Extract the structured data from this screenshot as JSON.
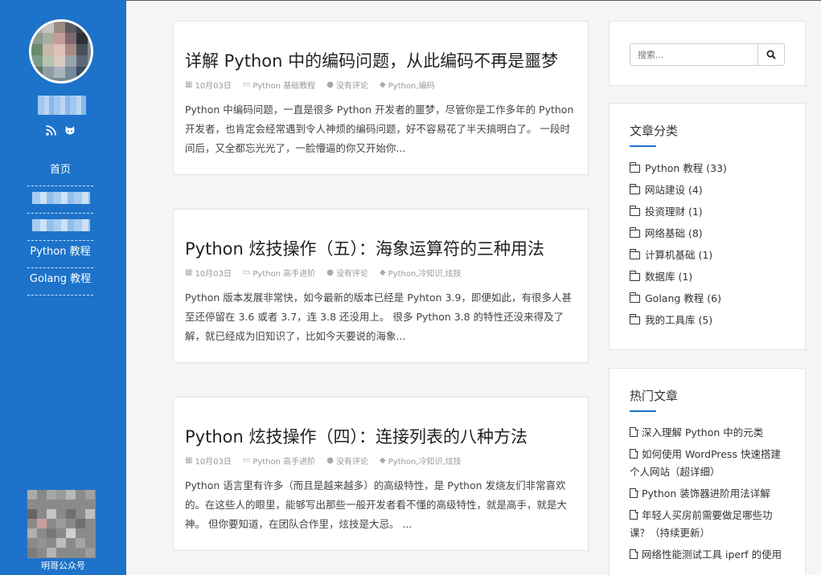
{
  "sidebar": {
    "social": {
      "rss_icon": "rss-icon",
      "github_icon": "github-icon"
    },
    "nav": [
      {
        "label": "首页"
      },
      {
        "label": ""
      },
      {
        "label": ""
      },
      {
        "label": "Python 教程"
      },
      {
        "label": "Golang 教程"
      }
    ],
    "qr_label": "明哥公众号"
  },
  "posts": [
    {
      "title": "详解 Python 中的编码问题，从此编码不再是噩梦",
      "date": "10月03日",
      "category": "Python 基础教程",
      "comments": "没有评论",
      "tags": "Python,编码",
      "excerpt": "Python 中编码问题，一直是很多 Python 开发者的噩梦，尽管你是工作多年的 Python 开发者，也肯定会经常遇到令人神烦的编码问题，好不容易花了半天搞明白了。 一段时间后，又全都忘光光了，一脸懵逼的你又开始你..."
    },
    {
      "title": "Python 炫技操作（五）：海象运算符的三种用法",
      "date": "10月03日",
      "category": "Python 高手进阶",
      "comments": "没有评论",
      "tags": "Python,冷知识,炫技",
      "excerpt": "Python 版本发展非常快，如今最新的版本已经是 Pyhton 3.9，即便如此，有很多人甚至还停留在 3.6 或者 3.7，连 3.8 还没用上。 很多 Python 3.8 的特性还没来得及了解，就已经成为旧知识了，比如今天要说的海象..."
    },
    {
      "title": "Python 炫技操作（四）：连接列表的八种方法",
      "date": "10月03日",
      "category": "Python 高手进阶",
      "comments": "没有评论",
      "tags": "Python,冷知识,炫技",
      "excerpt": "Python 语言里有许多（而且是越来越多）的高级特性，是 Python 发烧友们非常喜欢的。在这些人的眼里，能够写出那些一般开发者看不懂的高级特性，就是高手，就是大神。 但你要知道，在团队合作里，炫技是大忌。 ..."
    }
  ],
  "search": {
    "placeholder": "搜索..."
  },
  "categories": {
    "title": "文章分类",
    "items": [
      {
        "label": "Python 教程 (33)"
      },
      {
        "label": "网站建设 (4)"
      },
      {
        "label": "投资理财 (1)"
      },
      {
        "label": "网络基础 (8)"
      },
      {
        "label": "计算机基础 (1)"
      },
      {
        "label": "数据库 (1)"
      },
      {
        "label": "Golang 教程 (6)"
      },
      {
        "label": "我的工具库 (5)"
      }
    ]
  },
  "hot": {
    "title": "热门文章",
    "items": [
      {
        "label": "深入理解 Python 中的元类"
      },
      {
        "label": "如何使用 WordPress 快速搭建个人网站（超详细）"
      },
      {
        "label": "Python 装饰器进阶用法详解"
      },
      {
        "label": "年轻人买房前需要做足哪些功课？（持续更新）"
      },
      {
        "label": "网络性能测试工具 iperf 的使用"
      }
    ]
  },
  "colors": {
    "accent": "#1d73c9"
  }
}
